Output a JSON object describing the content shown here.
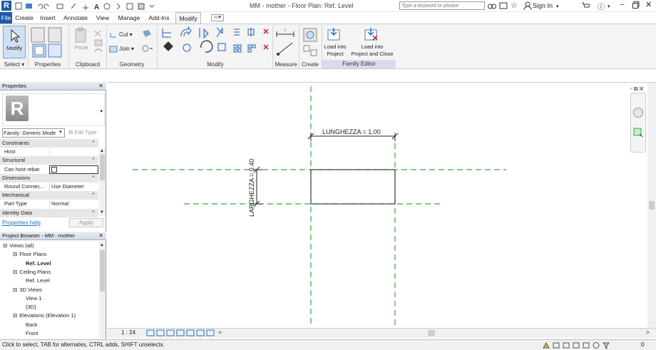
{
  "titlebar": {
    "title": "MM - mother - Floor Plan: Ref. Level",
    "search_placeholder": "Type a keyword or phrase",
    "sign_in": "Sign In"
  },
  "tabs": [
    "File",
    "Create",
    "Insert",
    "Annotate",
    "View",
    "Manage",
    "Add-Ins",
    "Modify"
  ],
  "ribbon": {
    "modify_label": "Modify",
    "groups": {
      "select": "Select",
      "properties": "Properties",
      "clipboard": "Clipboard",
      "geometry": "Geometry",
      "modify": "Modify",
      "measure": "Measure",
      "create": "Create",
      "family_editor": "Family Editor"
    },
    "paste": "Paste",
    "cut": "Cut",
    "join": "Join",
    "load_into_project": [
      "Load into",
      "Project"
    ],
    "load_into_project_close": [
      "Load into",
      "Project and Close"
    ]
  },
  "properties": {
    "header": "Properties",
    "family": "Family: Generic Mode",
    "edit_type": "Edit Type",
    "rows": [
      {
        "type": "cat",
        "label": "Constraints"
      },
      {
        "type": "row",
        "key": "Host",
        "value": ""
      },
      {
        "type": "cat",
        "label": "Structural"
      },
      {
        "type": "row",
        "key": "Can host rebar",
        "value": ""
      },
      {
        "type": "cat",
        "label": "Dimensions"
      },
      {
        "type": "row",
        "key": "Round Connec...",
        "value": "Use Diameter"
      },
      {
        "type": "cat",
        "label": "Mechanical"
      },
      {
        "type": "row",
        "key": "Part Type",
        "value": "Normal"
      },
      {
        "type": "cat",
        "label": "Identity Data"
      }
    ],
    "help_link": "Properties help",
    "apply": "Apply"
  },
  "browser": {
    "header": "Project Browser - MM - mother",
    "items": [
      {
        "label": "Views (all)",
        "indent": 0,
        "bold": false,
        "exp": "-"
      },
      {
        "label": "Floor Plans",
        "indent": 1,
        "bold": false,
        "exp": "-"
      },
      {
        "label": "Ref. Level",
        "indent": 2,
        "bold": true,
        "exp": ""
      },
      {
        "label": "Ceiling Plans",
        "indent": 1,
        "bold": false,
        "exp": "-"
      },
      {
        "label": "Ref. Level",
        "indent": 2,
        "bold": false,
        "exp": ""
      },
      {
        "label": "3D Views",
        "indent": 1,
        "bold": false,
        "exp": "-"
      },
      {
        "label": "View 1",
        "indent": 2,
        "bold": false,
        "exp": ""
      },
      {
        "label": "{3D}",
        "indent": 2,
        "bold": false,
        "exp": ""
      },
      {
        "label": "Elevations (Elevation 1)",
        "indent": 1,
        "bold": false,
        "exp": "-"
      },
      {
        "label": "Back",
        "indent": 2,
        "bold": false,
        "exp": ""
      },
      {
        "label": "Front",
        "indent": 2,
        "bold": false,
        "exp": ""
      }
    ]
  },
  "drawing": {
    "dim_length": "LUNGHEZZA = 1.00",
    "dim_width": "LARGHEZZA = 0.40"
  },
  "viewbar": {
    "scale": "1 : 24"
  },
  "status": {
    "text": "Click to select, TAB for alternates, CTRL adds, SHIFT unselects.",
    "filter_count": ":0"
  },
  "colors": {
    "ref_plane": "#3aaa3a",
    "accent": "#2a6ebb",
    "family_editor_bg": "#d9d9ef"
  }
}
